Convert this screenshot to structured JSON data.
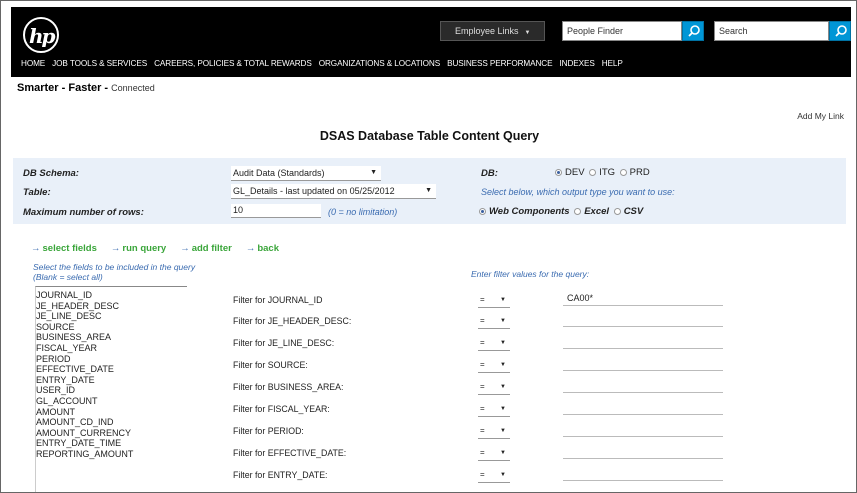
{
  "header": {
    "logo_text": "hp",
    "employee_links": "Employee Links",
    "people_finder_placeholder": "People Finder",
    "search_placeholder": "Search",
    "nav": [
      "HOME",
      "JOB TOOLS & SERVICES",
      "CAREERS, POLICIES & TOTAL REWARDS",
      "ORGANIZATIONS & LOCATIONS",
      "BUSINESS PERFORMANCE",
      "INDEXES",
      "HELP"
    ]
  },
  "tagline": {
    "smarter": "Smarter",
    "faster": "- Faster -",
    "connected": "Connected"
  },
  "add_my_link": "Add My Link",
  "page_title": "DSAS Database Table Content Query",
  "form": {
    "db_schema_label": "DB Schema:",
    "db_schema_value": "Audit Data (Standards)",
    "table_label": "Table:",
    "table_value": "GL_Details - last updated on 05/25/2012",
    "max_rows_label": "Maximum number of rows:",
    "max_rows_value": "10",
    "max_rows_hint": "(0 = no limitation)",
    "db_label": "DB:",
    "db_options": [
      "DEV",
      "ITG",
      "PRD"
    ],
    "db_selected": "DEV",
    "output_hint": "Select below, which output type you want to use:",
    "output_options": [
      "Web Components",
      "Excel",
      "CSV"
    ],
    "output_selected": "Web Components"
  },
  "actions": {
    "select_fields": "select fields",
    "run_query": "run query",
    "add_filter": "add filter",
    "back": "back"
  },
  "fields_hint": "Select the fields to be included in the query (Blank = select all)",
  "filter_hint": "Enter filter values for the query:",
  "fields": [
    "JOURNAL_ID",
    "JE_HEADER_DESC",
    "JE_LINE_DESC",
    "SOURCE",
    "BUSINESS_AREA",
    "FISCAL_YEAR",
    "PERIOD",
    "EFFECTIVE_DATE",
    "ENTRY_DATE",
    "USER_ID",
    "GL_ACCOUNT",
    "AMOUNT",
    "AMOUNT_CD_IND",
    "AMOUNT_CURRENCY",
    "ENTRY_DATE_TIME",
    "REPORTING_AMOUNT"
  ],
  "filters": [
    {
      "label": "Filter for JOURNAL_ID",
      "op": "=",
      "value": "CA00*"
    },
    {
      "label": "Filter for JE_HEADER_DESC:",
      "op": "=",
      "value": ""
    },
    {
      "label": "Filter for JE_LINE_DESC:",
      "op": "=",
      "value": ""
    },
    {
      "label": "Filter for SOURCE:",
      "op": "=",
      "value": ""
    },
    {
      "label": "Filter for BUSINESS_AREA:",
      "op": "=",
      "value": ""
    },
    {
      "label": "Filter for FISCAL_YEAR:",
      "op": "=",
      "value": ""
    },
    {
      "label": "Filter for PERIOD:",
      "op": "=",
      "value": ""
    },
    {
      "label": "Filter for EFFECTIVE_DATE:",
      "op": "=",
      "value": ""
    },
    {
      "label": "Filter for ENTRY_DATE:",
      "op": "=",
      "value": ""
    }
  ],
  "colors": {
    "header_bg": "#000000",
    "panel_bg": "#e9f0f9",
    "accent_blue": "#0096d6",
    "hint_blue": "#3a6bb0",
    "action_green": "#3aa53a"
  }
}
